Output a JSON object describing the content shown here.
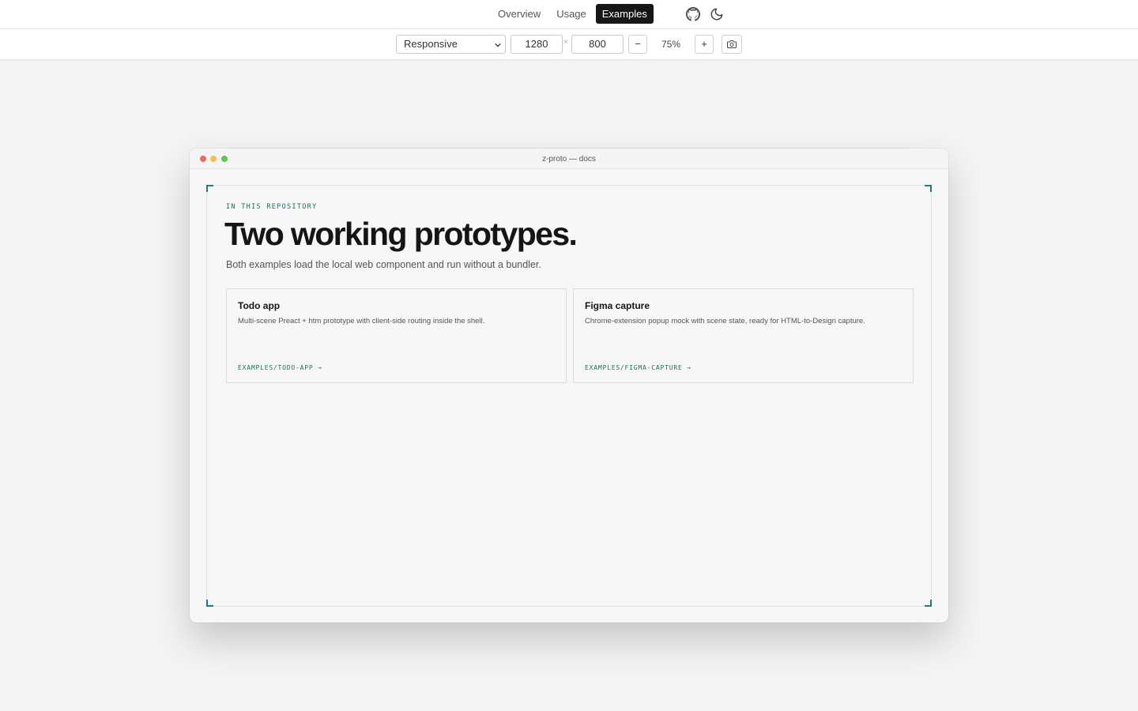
{
  "nav": {
    "tabs": [
      {
        "label": "Overview"
      },
      {
        "label": "Usage"
      },
      {
        "label": "Examples",
        "active": true
      }
    ],
    "icons": [
      "github-icon",
      "moon-icon"
    ]
  },
  "toolbar": {
    "device_select": "Responsive",
    "width": "1280",
    "times": "×",
    "height": "800",
    "minus_label": "−",
    "zoom": "75%",
    "plus_label": "+",
    "camera_icon": "camera-icon"
  },
  "window": {
    "title": "z-proto — docs",
    "dots": [
      "#ec6a5e",
      "#f4bf4f",
      "#61c554"
    ],
    "accent": "#1f7a7a"
  },
  "page": {
    "eyebrow": "IN THIS REPOSITORY",
    "headline": "Two working prototypes.",
    "lede": "Both examples load the local web component and run without a bundler.",
    "cards": [
      {
        "title": "Todo app",
        "description": "Multi-scene Preact + htm prototype with client-side routing inside the shell.",
        "link": "EXAMPLES/TODO-APP →"
      },
      {
        "title": "Figma capture",
        "description": "Chrome-extension popup mock with scene state, ready for HTML-to-Design capture.",
        "link": "EXAMPLES/FIGMA-CAPTURE →"
      }
    ]
  }
}
